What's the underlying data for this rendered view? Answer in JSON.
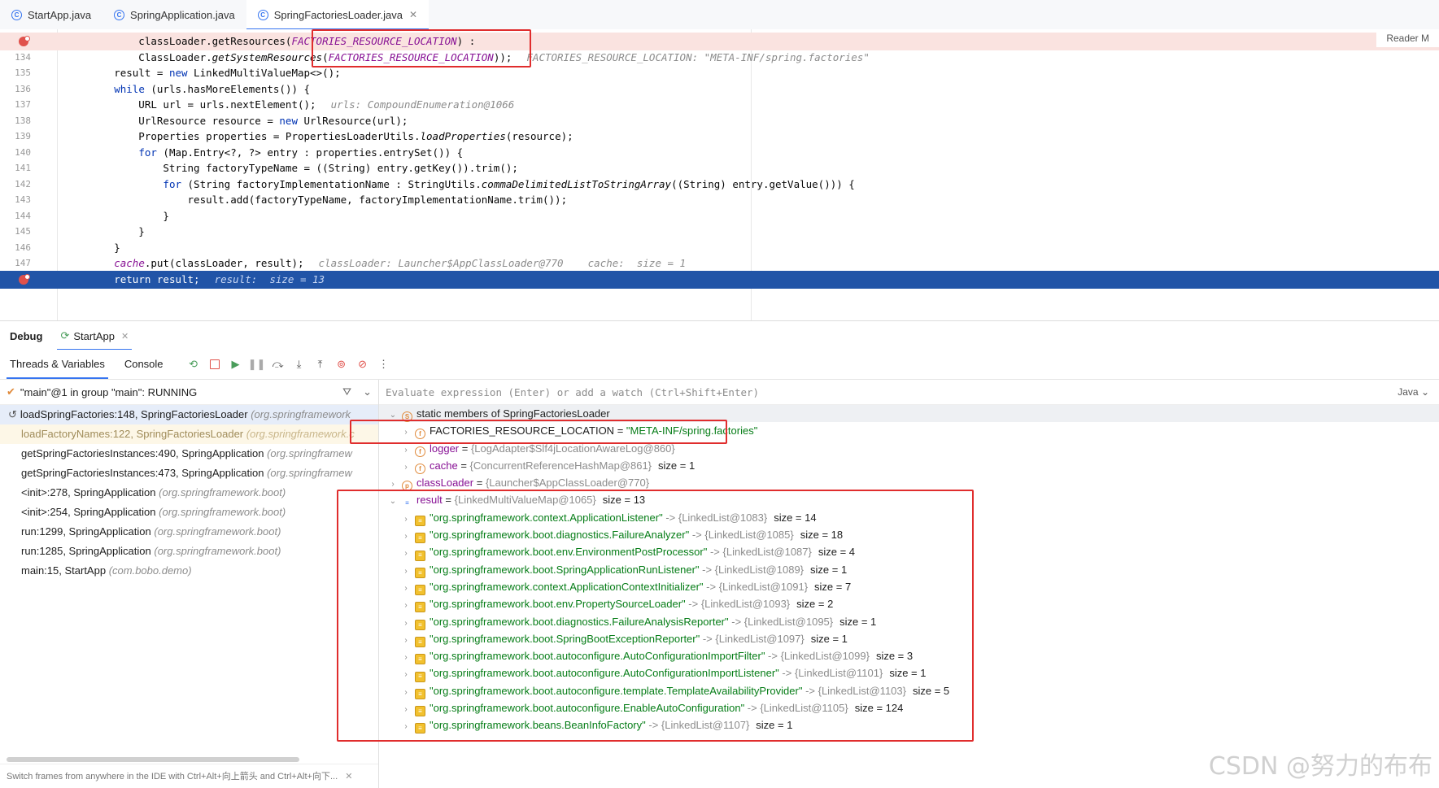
{
  "tabs": [
    {
      "label": "StartApp.java",
      "active": false
    },
    {
      "label": "SpringApplication.java",
      "active": false
    },
    {
      "label": "SpringFactoriesLoader.java",
      "active": true
    }
  ],
  "editor": {
    "reader_mode": "Reader M",
    "lines": [
      {
        "num": "",
        "bp": true,
        "code": [
          {
            "t": "            classLoader.getResources("
          },
          {
            "t": "FACTORIES_RESOURCE_LOCATION",
            "c": "const"
          },
          {
            "t": ") :"
          }
        ],
        "hint": ""
      },
      {
        "num": "134",
        "code": [
          {
            "t": "            ClassLoader."
          },
          {
            "t": "getSystemResources",
            "c": "it"
          },
          {
            "t": "("
          },
          {
            "t": "FACTORIES_RESOURCE_LOCATION",
            "c": "const"
          },
          {
            "t": "));"
          }
        ],
        "hint": "FACTORIES_RESOURCE_LOCATION: \"META-INF/spring.factories\""
      },
      {
        "num": "135",
        "code": [
          {
            "t": "        result = "
          },
          {
            "t": "new",
            "c": "kw"
          },
          {
            "t": " LinkedMultiValueMap<>();"
          }
        ],
        "hint": ""
      },
      {
        "num": "136",
        "code": [
          {
            "t": "        "
          },
          {
            "t": "while",
            "c": "kw"
          },
          {
            "t": " (urls.hasMoreElements()) {"
          }
        ],
        "hint": ""
      },
      {
        "num": "137",
        "code": [
          {
            "t": "            URL url = urls.nextElement();"
          }
        ],
        "hint": "urls: CompoundEnumeration@1066"
      },
      {
        "num": "138",
        "code": [
          {
            "t": "            UrlResource resource = "
          },
          {
            "t": "new",
            "c": "kw"
          },
          {
            "t": " UrlResource(url);"
          }
        ],
        "hint": ""
      },
      {
        "num": "139",
        "code": [
          {
            "t": "            Properties properties = PropertiesLoaderUtils."
          },
          {
            "t": "loadProperties",
            "c": "it"
          },
          {
            "t": "(resource);"
          }
        ],
        "hint": ""
      },
      {
        "num": "140",
        "code": [
          {
            "t": "            "
          },
          {
            "t": "for",
            "c": "kw"
          },
          {
            "t": " (Map.Entry<?, ?> entry : properties.entrySet()) {"
          }
        ],
        "hint": ""
      },
      {
        "num": "141",
        "code": [
          {
            "t": "                String factoryTypeName = ((String) entry.getKey()).trim();"
          }
        ],
        "hint": ""
      },
      {
        "num": "142",
        "code": [
          {
            "t": "                "
          },
          {
            "t": "for",
            "c": "kw"
          },
          {
            "t": " (String factoryImplementationName : StringUtils."
          },
          {
            "t": "commaDelimitedListToStringArray",
            "c": "it"
          },
          {
            "t": "((String) entry.getValue())) {"
          }
        ],
        "hint": ""
      },
      {
        "num": "143",
        "code": [
          {
            "t": "                    result.add(factoryTypeName, factoryImplementationName.trim());"
          }
        ],
        "hint": ""
      },
      {
        "num": "144",
        "code": [
          {
            "t": "                }"
          }
        ],
        "hint": ""
      },
      {
        "num": "145",
        "code": [
          {
            "t": "            }"
          }
        ],
        "hint": ""
      },
      {
        "num": "146",
        "code": [
          {
            "t": "        }"
          }
        ],
        "hint": ""
      },
      {
        "num": "147",
        "code": [
          {
            "t": "        "
          },
          {
            "t": "cache",
            "c": "const"
          },
          {
            "t": ".put(classLoader, result);"
          }
        ],
        "hint": "classLoader: Launcher$AppClassLoader@770    cache:  size = 1"
      },
      {
        "num": "",
        "bp": true,
        "current": true,
        "code": [
          {
            "t": "        "
          },
          {
            "t": "return",
            "c": "kw"
          },
          {
            "t": " result;"
          }
        ],
        "hint": "result:  size = 13"
      }
    ]
  },
  "debug": {
    "title": "Debug",
    "session_tab": "StartApp",
    "toolbar_tabs": [
      "Threads & Variables",
      "Console"
    ],
    "thread_status": "\"main\"@1 in group \"main\": RUNNING",
    "frames": [
      {
        "method": "loadSpringFactories:148, SpringFactoriesLoader",
        "pkg": "(org.springframework",
        "kind": "sel"
      },
      {
        "method": "loadFactoryNames:122, SpringFactoriesLoader",
        "pkg": "(org.springframework.c",
        "kind": "lib"
      },
      {
        "method": "getSpringFactoriesInstances:490, SpringApplication",
        "pkg": "(org.springframew",
        "kind": ""
      },
      {
        "method": "getSpringFactoriesInstances:473, SpringApplication",
        "pkg": "(org.springframew",
        "kind": ""
      },
      {
        "method": "<init>:278, SpringApplication",
        "pkg": "(org.springframework.boot)",
        "kind": ""
      },
      {
        "method": "<init>:254, SpringApplication",
        "pkg": "(org.springframework.boot)",
        "kind": ""
      },
      {
        "method": "run:1299, SpringApplication",
        "pkg": "(org.springframework.boot)",
        "kind": ""
      },
      {
        "method": "run:1285, SpringApplication",
        "pkg": "(org.springframework.boot)",
        "kind": ""
      },
      {
        "method": "main:15, StartApp",
        "pkg": "(com.bobo.demo)",
        "kind": ""
      }
    ],
    "footer_hint": "Switch frames from anywhere in the IDE with Ctrl+Alt+向上箭头 and Ctrl+Alt+向下...",
    "eval_placeholder": "Evaluate expression (Enter) or add a watch (Ctrl+Shift+Enter)",
    "eval_lang": "Java",
    "variables": [
      {
        "indent": 0,
        "arrow": "down",
        "icon": "S",
        "name": "static members of SpringFactoriesLoader",
        "plain": true,
        "grey": true
      },
      {
        "indent": 1,
        "arrow": "right",
        "icon": "f",
        "name": "FACTORIES_RESOURCE_LOCATION",
        "plain": true,
        "value": "\"META-INF/spring.factories\"",
        "valueType": "str"
      },
      {
        "indent": 1,
        "arrow": "right",
        "icon": "f",
        "name": "logger",
        "value": "{LogAdapter$Slf4jLocationAwareLog@860}"
      },
      {
        "indent": 1,
        "arrow": "right",
        "icon": "f",
        "name": "cache",
        "value": "{ConcurrentReferenceHashMap@861}",
        "size": "size = 1"
      },
      {
        "indent": 0,
        "arrow": "right",
        "icon": "p",
        "name": "classLoader",
        "value": "{Launcher$AppClassLoader@770}"
      },
      {
        "indent": 0,
        "arrow": "down",
        "icon": "list",
        "name": "result",
        "value": "{LinkedMultiValueMap@1065}",
        "size": "size = 13"
      },
      {
        "indent": 1,
        "arrow": "right",
        "icon": "map",
        "key": "\"org.springframework.context.ApplicationListener\"",
        "value": "{LinkedList@1083}",
        "size": "size = 14"
      },
      {
        "indent": 1,
        "arrow": "right",
        "icon": "map",
        "key": "\"org.springframework.boot.diagnostics.FailureAnalyzer\"",
        "value": "{LinkedList@1085}",
        "size": "size = 18"
      },
      {
        "indent": 1,
        "arrow": "right",
        "icon": "map",
        "key": "\"org.springframework.boot.env.EnvironmentPostProcessor\"",
        "value": "{LinkedList@1087}",
        "size": "size = 4"
      },
      {
        "indent": 1,
        "arrow": "right",
        "icon": "map",
        "key": "\"org.springframework.boot.SpringApplicationRunListener\"",
        "value": "{LinkedList@1089}",
        "size": "size = 1"
      },
      {
        "indent": 1,
        "arrow": "right",
        "icon": "map",
        "key": "\"org.springframework.context.ApplicationContextInitializer\"",
        "value": "{LinkedList@1091}",
        "size": "size = 7"
      },
      {
        "indent": 1,
        "arrow": "right",
        "icon": "map",
        "key": "\"org.springframework.boot.env.PropertySourceLoader\"",
        "value": "{LinkedList@1093}",
        "size": "size = 2"
      },
      {
        "indent": 1,
        "arrow": "right",
        "icon": "map",
        "key": "\"org.springframework.boot.diagnostics.FailureAnalysisReporter\"",
        "value": "{LinkedList@1095}",
        "size": "size = 1"
      },
      {
        "indent": 1,
        "arrow": "right",
        "icon": "map",
        "key": "\"org.springframework.boot.SpringBootExceptionReporter\"",
        "value": "{LinkedList@1097}",
        "size": "size = 1"
      },
      {
        "indent": 1,
        "arrow": "right",
        "icon": "map",
        "key": "\"org.springframework.boot.autoconfigure.AutoConfigurationImportFilter\"",
        "value": "{LinkedList@1099}",
        "size": "size = 3"
      },
      {
        "indent": 1,
        "arrow": "right",
        "icon": "map",
        "key": "\"org.springframework.boot.autoconfigure.AutoConfigurationImportListener\"",
        "value": "{LinkedList@1101}",
        "size": "size = 1"
      },
      {
        "indent": 1,
        "arrow": "right",
        "icon": "map",
        "key": "\"org.springframework.boot.autoconfigure.template.TemplateAvailabilityProvider\"",
        "value": "{LinkedList@1103}",
        "size": "size = 5"
      },
      {
        "indent": 1,
        "arrow": "right",
        "icon": "map",
        "key": "\"org.springframework.boot.autoconfigure.EnableAutoConfiguration\"",
        "value": "{LinkedList@1105}",
        "size": "size = 124"
      },
      {
        "indent": 1,
        "arrow": "right",
        "icon": "map",
        "key": "\"org.springframework.beans.BeanInfoFactory\"",
        "value": "{LinkedList@1107}",
        "size": "size = 1"
      }
    ]
  },
  "watermark": "CSDN @努力的布布",
  "colors": {
    "accent": "#3574f0",
    "current_line": "#2154a7",
    "breakpoint": "#e0514b",
    "annotation": "#e02d2d"
  }
}
